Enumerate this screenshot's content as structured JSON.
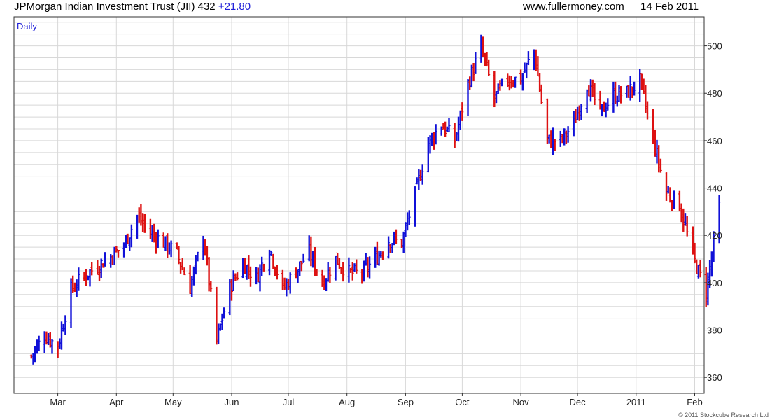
{
  "header": {
    "title": "JPMorgan Indian Investment Trust (JII) 432",
    "change": "+21.80",
    "site": "www.fullermoney.com",
    "date": "14 Feb 2011"
  },
  "footer": {
    "copyright": "© 2011 Stockcube Research Ltd"
  },
  "colors": {
    "up": "#1010d8",
    "down": "#dd1111",
    "grid": "#d8d8d8",
    "accent": "#1e1ed8"
  },
  "chart_data": {
    "type": "ohlc",
    "period_label": "Daily",
    "title": "JPMorgan Indian Investment Trust (JII)",
    "xlabel": "",
    "ylabel": "",
    "ylim": [
      356,
      512
    ],
    "y_ticks": [
      360,
      380,
      400,
      420,
      440,
      460,
      480,
      500
    ],
    "x_tick_labels": [
      "Mar",
      "Apr",
      "May",
      "Jun",
      "Jul",
      "Aug",
      "Sep",
      "Oct",
      "Nov",
      "Dec",
      "2011",
      "Feb"
    ],
    "grid": true,
    "last_close": 432,
    "last_change": 21.8,
    "series": [
      {
        "name": "JII",
        "close_points": [
          [
            "2010-02-15",
            369
          ],
          [
            "2010-02-22",
            378
          ],
          [
            "2010-03-01",
            373
          ],
          [
            "2010-03-08",
            397
          ],
          [
            "2010-03-15",
            403
          ],
          [
            "2010-03-22",
            407
          ],
          [
            "2010-03-29",
            411
          ],
          [
            "2010-04-05",
            416
          ],
          [
            "2010-04-12",
            428
          ],
          [
            "2010-04-19",
            421
          ],
          [
            "2010-04-26",
            417
          ],
          [
            "2010-05-03",
            412
          ],
          [
            "2010-05-10",
            398
          ],
          [
            "2010-05-17",
            420
          ],
          [
            "2010-05-24",
            375
          ],
          [
            "2010-05-31",
            398
          ],
          [
            "2010-06-07",
            408
          ],
          [
            "2010-06-14",
            402
          ],
          [
            "2010-06-21",
            415
          ],
          [
            "2010-06-28",
            397
          ],
          [
            "2010-07-05",
            405
          ],
          [
            "2010-07-12",
            413
          ],
          [
            "2010-07-19",
            400
          ],
          [
            "2010-07-26",
            410
          ],
          [
            "2010-08-02",
            404
          ],
          [
            "2010-08-09",
            404
          ],
          [
            "2010-08-16",
            410
          ],
          [
            "2010-08-23",
            418
          ],
          [
            "2010-08-30",
            417
          ],
          [
            "2010-09-06",
            437
          ],
          [
            "2010-09-13",
            459
          ],
          [
            "2010-09-20",
            467
          ],
          [
            "2010-09-27",
            460
          ],
          [
            "2010-10-04",
            484
          ],
          [
            "2010-10-11",
            499
          ],
          [
            "2010-10-18",
            478
          ],
          [
            "2010-10-25",
            486
          ],
          [
            "2010-11-01",
            486
          ],
          [
            "2010-11-08",
            498
          ],
          [
            "2010-11-15",
            460
          ],
          [
            "2010-11-22",
            460
          ],
          [
            "2010-11-29",
            467
          ],
          [
            "2010-12-06",
            484
          ],
          [
            "2010-12-13",
            472
          ],
          [
            "2010-12-20",
            479
          ],
          [
            "2010-12-27",
            480
          ],
          [
            "2011-01-03",
            485
          ],
          [
            "2011-01-10",
            460
          ],
          [
            "2011-01-17",
            438
          ],
          [
            "2011-01-24",
            433
          ],
          [
            "2011-01-31",
            411
          ],
          [
            "2011-02-07",
            396
          ],
          [
            "2011-02-14",
            432
          ]
        ]
      }
    ]
  }
}
